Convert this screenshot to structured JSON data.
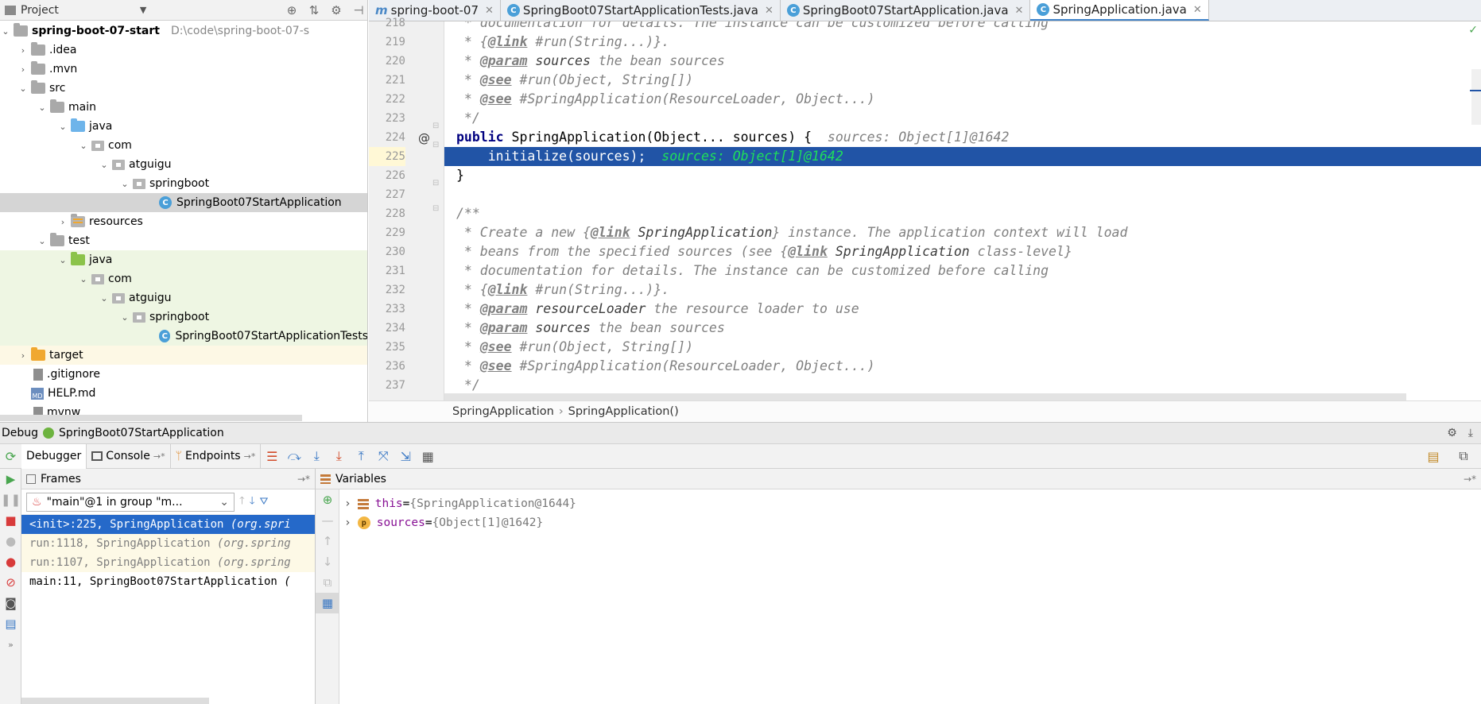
{
  "project": {
    "header_label": "Project",
    "root_name": "spring-boot-07-start",
    "root_path": "D:\\code\\spring-boot-07-s",
    "items": [
      {
        "label": ".idea"
      },
      {
        "label": ".mvn"
      },
      {
        "label": "src"
      },
      {
        "label": "main"
      },
      {
        "label": "java"
      },
      {
        "label": "com"
      },
      {
        "label": "atguigu"
      },
      {
        "label": "springboot"
      },
      {
        "label": "SpringBoot07StartApplication"
      },
      {
        "label": "resources"
      },
      {
        "label": "test"
      },
      {
        "label": "java"
      },
      {
        "label": "com"
      },
      {
        "label": "atguigu"
      },
      {
        "label": "springboot"
      },
      {
        "label": "SpringBoot07StartApplicationTests"
      },
      {
        "label": "target"
      },
      {
        "label": ".gitignore"
      },
      {
        "label": "HELP.md"
      },
      {
        "label": "mvnw"
      }
    ]
  },
  "editor": {
    "tabs": [
      {
        "icon": "m",
        "label": "spring-boot-07"
      },
      {
        "icon": "C",
        "label": "SpringBoot07StartApplicationTests.java"
      },
      {
        "icon": "C",
        "label": "SpringBoot07StartApplication.java"
      },
      {
        "icon": "C",
        "label": "SpringApplication.java"
      }
    ],
    "line_numbers": [
      "218",
      "219",
      "220",
      "221",
      "222",
      "223",
      "224",
      "225",
      "226",
      "227",
      "228",
      "229",
      "230",
      "231",
      "232",
      "233",
      "234",
      "235",
      "236",
      "237"
    ],
    "code": {
      "l218": " * documentation for details. The instance can be customized before calling",
      "l219_pre": " * {",
      "l219_tag": "@link",
      "l219_post": " #run(String...)}.",
      "l220_pre": " * ",
      "l220_tag": "@param",
      "l220_ref": " sources",
      "l220_post": " the bean sources",
      "l221_pre": " * ",
      "l221_tag": "@see",
      "l221_post": " #run(Object, String[])",
      "l222_pre": " * ",
      "l222_tag": "@see",
      "l222_post": " #SpringApplication(ResourceLoader, Object...)",
      "l223": " */",
      "l224_kw": "public",
      "l224_code": " SpringApplication(Object... sources) {",
      "l224_hint": "sources: Object[1]@1642",
      "l225_code": "    initialize(sources);",
      "l225_hint": "sources: Object[1]@1642",
      "l226": "}",
      "l227": "",
      "l228": "/**",
      "l229_pre": " * Create a new {",
      "l229_tag": "@link",
      "l229_ref": " SpringApplication",
      "l229_post": "} instance. The application context will load",
      "l230_pre": " * beans from the specified sources (see {",
      "l230_tag": "@link",
      "l230_ref": " SpringApplication",
      "l230_post": " class-level}",
      "l231": " * documentation for details. The instance can be customized before calling",
      "l232_pre": " * {",
      "l232_tag": "@link",
      "l232_post": " #run(String...)}.",
      "l233_pre": " * ",
      "l233_tag": "@param",
      "l233_ref": " resourceLoader",
      "l233_post": " the resource loader to use",
      "l234_pre": " * ",
      "l234_tag": "@param",
      "l234_ref": " sources",
      "l234_post": " the bean sources",
      "l235_pre": " * ",
      "l235_tag": "@see",
      "l235_post": " #run(Object, String[])",
      "l236_pre": " * ",
      "l236_tag": "@see",
      "l236_post": " #SpringApplication(ResourceLoader, Object...)",
      "l237": " */",
      "gutter_mark": "@"
    },
    "breadcrumb": [
      "SpringApplication",
      "SpringApplication()"
    ],
    "breadcrumb_sep": "›"
  },
  "debug": {
    "title": "Debug",
    "config": "SpringBoot07StartApplication",
    "tabs": [
      {
        "label": "Debugger"
      },
      {
        "label": "Console"
      },
      {
        "label": "Endpoints"
      }
    ],
    "tab_suffix": "→*",
    "frames_title": "Frames",
    "thread": "\"main\"@1 in group \"m...",
    "frames": [
      {
        "method": "<init>:225, SpringApplication",
        "pkg": " (org.spri"
      },
      {
        "method": "run:1118, SpringApplication",
        "pkg": " (org.spring"
      },
      {
        "method": "run:1107, SpringApplication",
        "pkg": " (org.spring"
      },
      {
        "method": "main:11, SpringBoot07StartApplication",
        "pkg": " ("
      }
    ],
    "variables_title": "Variables",
    "variables": [
      {
        "name": "this",
        "eq": " = ",
        "value": "{SpringApplication@1644}"
      },
      {
        "name": "sources",
        "eq": " = ",
        "value": "{Object[1]@1642}"
      }
    ]
  },
  "colors": {
    "selection": "#2154a6",
    "frame_selected": "#2569c9",
    "test_bg": "#eef6e3",
    "inline_hint_current": "#1fe05a"
  }
}
